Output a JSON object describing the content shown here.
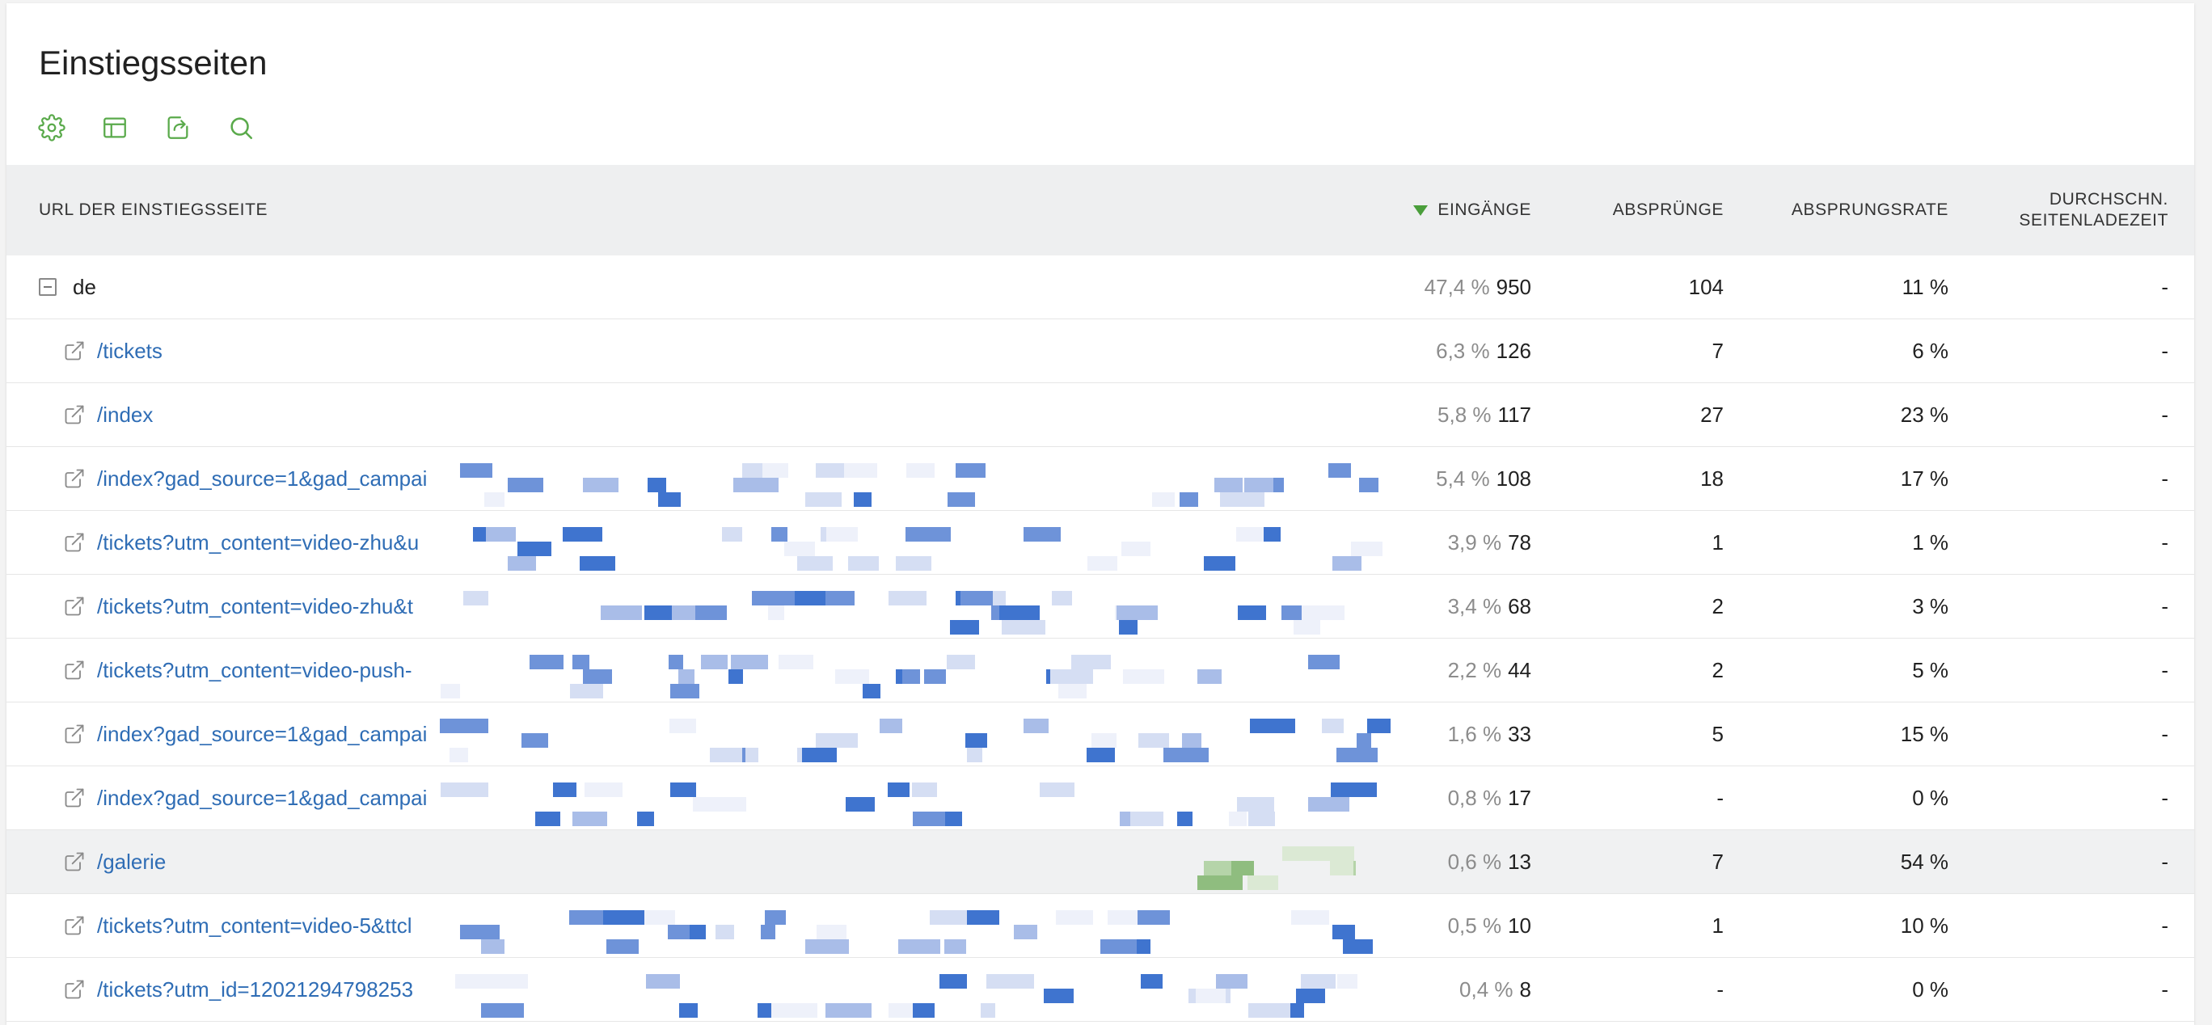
{
  "page": {
    "title": "Einstiegsseiten"
  },
  "toolbar": {
    "icons": [
      "gear-icon",
      "table-icon",
      "export-icon",
      "search-icon"
    ],
    "accent_color": "#5aaa4b"
  },
  "table": {
    "headers": {
      "url": "URL DER EINSTIEGSSEITE",
      "visits": "EINGÄNGE",
      "bounces": "ABSPRÜNGE",
      "bounce_rate": "ABSPRUNGSRATE",
      "load_time_line1": "DURCHSCHN.",
      "load_time_line2": "SEITENLADEZEIT"
    },
    "sort": {
      "column": "visits",
      "direction": "descending"
    },
    "group": {
      "label": "de",
      "visits_pct": "47,4 %",
      "visits": "950",
      "bounces": "104",
      "bounce_rate": "11 %",
      "load_time": "-"
    },
    "rows": [
      {
        "url": "/tickets",
        "visits_pct": "6,3 %",
        "visits": "126",
        "bounces": "7",
        "bounce_rate": "6 %",
        "load_time": "-"
      },
      {
        "url": "/index",
        "visits_pct": "5,8 %",
        "visits": "117",
        "bounces": "27",
        "bounce_rate": "23 %",
        "load_time": "-"
      },
      {
        "url": "/index?gad_source=1&gad_campai",
        "visits_pct": "5,4 %",
        "visits": "108",
        "bounces": "18",
        "bounce_rate": "17 %",
        "load_time": "-"
      },
      {
        "url": "/tickets?utm_content=video-zhu&u",
        "visits_pct": "3,9 %",
        "visits": "78",
        "bounces": "1",
        "bounce_rate": "1 %",
        "load_time": "-"
      },
      {
        "url": "/tickets?utm_content=video-zhu&t",
        "visits_pct": "3,4 %",
        "visits": "68",
        "bounces": "2",
        "bounce_rate": "3 %",
        "load_time": "-"
      },
      {
        "url": "/tickets?utm_content=video-push-",
        "visits_pct": "2,2 %",
        "visits": "44",
        "bounces": "2",
        "bounce_rate": "5 %",
        "load_time": "-"
      },
      {
        "url": "/index?gad_source=1&gad_campai",
        "visits_pct": "1,6 %",
        "visits": "33",
        "bounces": "5",
        "bounce_rate": "15 %",
        "load_time": "-"
      },
      {
        "url": "/index?gad_source=1&gad_campai",
        "visits_pct": "0,8 %",
        "visits": "17",
        "bounces": "-",
        "bounce_rate": "0 %",
        "load_time": "-"
      },
      {
        "url": "/galerie",
        "visits_pct": "0,6 %",
        "visits": "13",
        "bounces": "7",
        "bounce_rate": "54 %",
        "load_time": "-"
      },
      {
        "url": "/tickets?utm_content=video-5&ttcl",
        "visits_pct": "0,5 %",
        "visits": "10",
        "bounces": "1",
        "bounce_rate": "10 %",
        "load_time": "-"
      },
      {
        "url": "/tickets?utm_id=12021294798253",
        "visits_pct": "0,4 %",
        "visits": "8",
        "bounces": "-",
        "bounce_rate": "0 %",
        "load_time": "-"
      }
    ]
  }
}
